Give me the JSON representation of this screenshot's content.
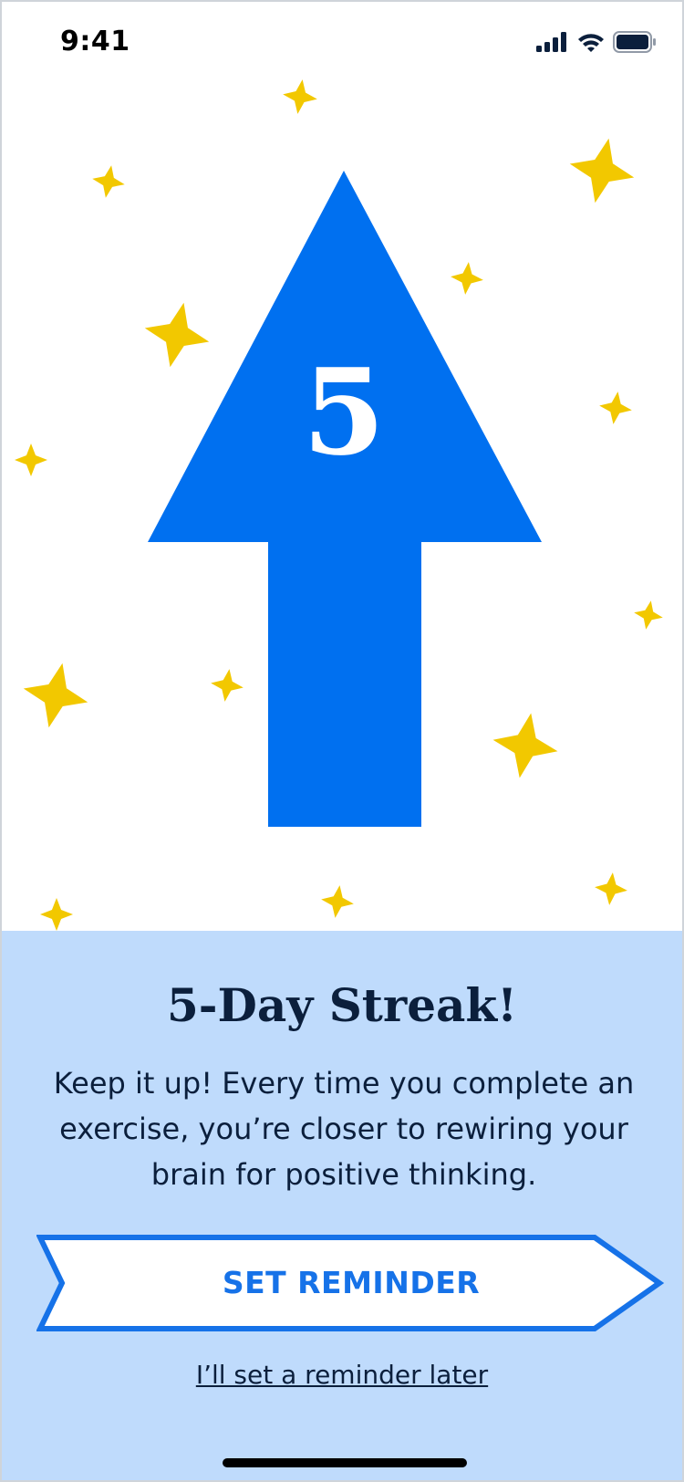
{
  "status_bar": {
    "time": "9:41",
    "icons": [
      "signal-icon",
      "wifi-icon",
      "battery-icon"
    ]
  },
  "hero": {
    "streak_count": "5",
    "arrow_icon": "arrow-up-icon",
    "decoration_icon": "star-icon",
    "colors": {
      "arrow": "#0070f0",
      "stars": "#f2c800"
    }
  },
  "panel": {
    "title": "5-Day Streak!",
    "body": "Keep it up! Every time you complete an exercise, you’re closer to rewiring your brain for positive thinking.",
    "primary_button": "SET REMINDER",
    "secondary_link": "I’ll set a reminder later",
    "colors": {
      "background": "#bfdbfc",
      "button_border": "#1672e8",
      "text": "#0b1f3c"
    }
  }
}
